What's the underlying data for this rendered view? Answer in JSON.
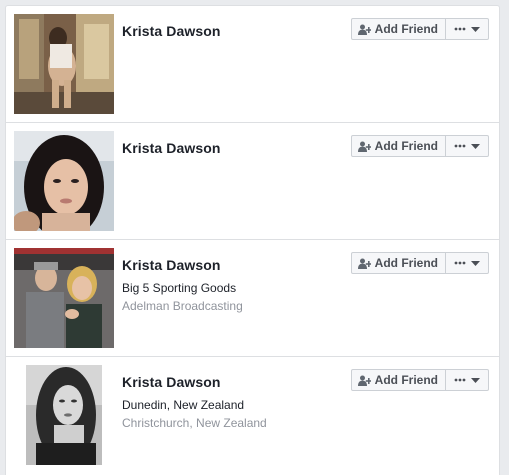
{
  "results": [
    {
      "name": "Krista Dawson",
      "line1": "",
      "line2": "",
      "photo": "profile-photo-mirror-selfie",
      "add_friend_label": "Add Friend",
      "more_icon": "ellipsis-icon"
    },
    {
      "name": "Krista Dawson",
      "line1": "",
      "line2": "",
      "photo": "profile-photo-selfie",
      "add_friend_label": "Add Friend",
      "more_icon": "ellipsis-icon"
    },
    {
      "name": "Krista Dawson",
      "line1": "Big 5 Sporting Goods",
      "line2": "Adelman Broadcasting",
      "photo": "profile-photo-couple",
      "add_friend_label": "Add Friend",
      "more_icon": "ellipsis-icon"
    },
    {
      "name": "Krista Dawson",
      "line1": "Dunedin, New Zealand",
      "line2": "Christchurch, New Zealand",
      "photo": "profile-photo-black-and-white",
      "add_friend_label": "Add Friend",
      "more_icon": "ellipsis-icon"
    }
  ],
  "colors": {
    "name_text": "#1d2129",
    "secondary_text": "#90949c",
    "button_bg": "#f6f7f9",
    "button_border": "#ccd0d5",
    "button_text": "#4b4f56",
    "divider": "#dddfe2"
  }
}
